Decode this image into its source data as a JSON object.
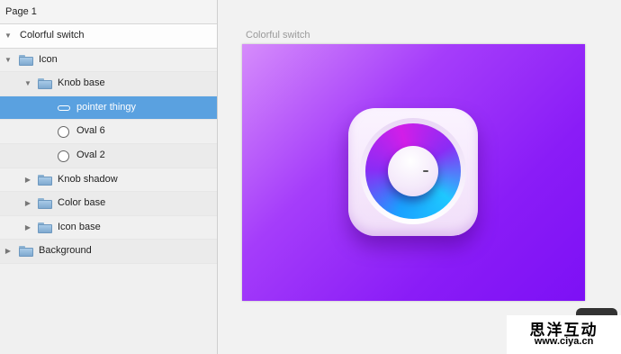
{
  "page": {
    "title": "Page 1"
  },
  "layers": {
    "artboard": "Colorful switch",
    "icon_group": "Icon",
    "knob_base": "Knob base",
    "pointer_thingy": "pointer thingy",
    "oval6": "Oval 6",
    "oval2": "Oval 2",
    "knob_shadow": "Knob shadow",
    "color_base": "Color base",
    "icon_base": "Icon base",
    "background": "Background"
  },
  "canvas": {
    "artboard_title": "Colorful switch"
  },
  "colors": {
    "selection": "#5aa1e0",
    "artboard_gradient_start": "#d68cfb",
    "artboard_gradient_end": "#7d10f5"
  },
  "icons": {
    "disclosure_open": "▼",
    "disclosure_closed": "▶"
  },
  "watermark": {
    "chinese": "思洋互动",
    "url": "www.ciya.cn"
  }
}
